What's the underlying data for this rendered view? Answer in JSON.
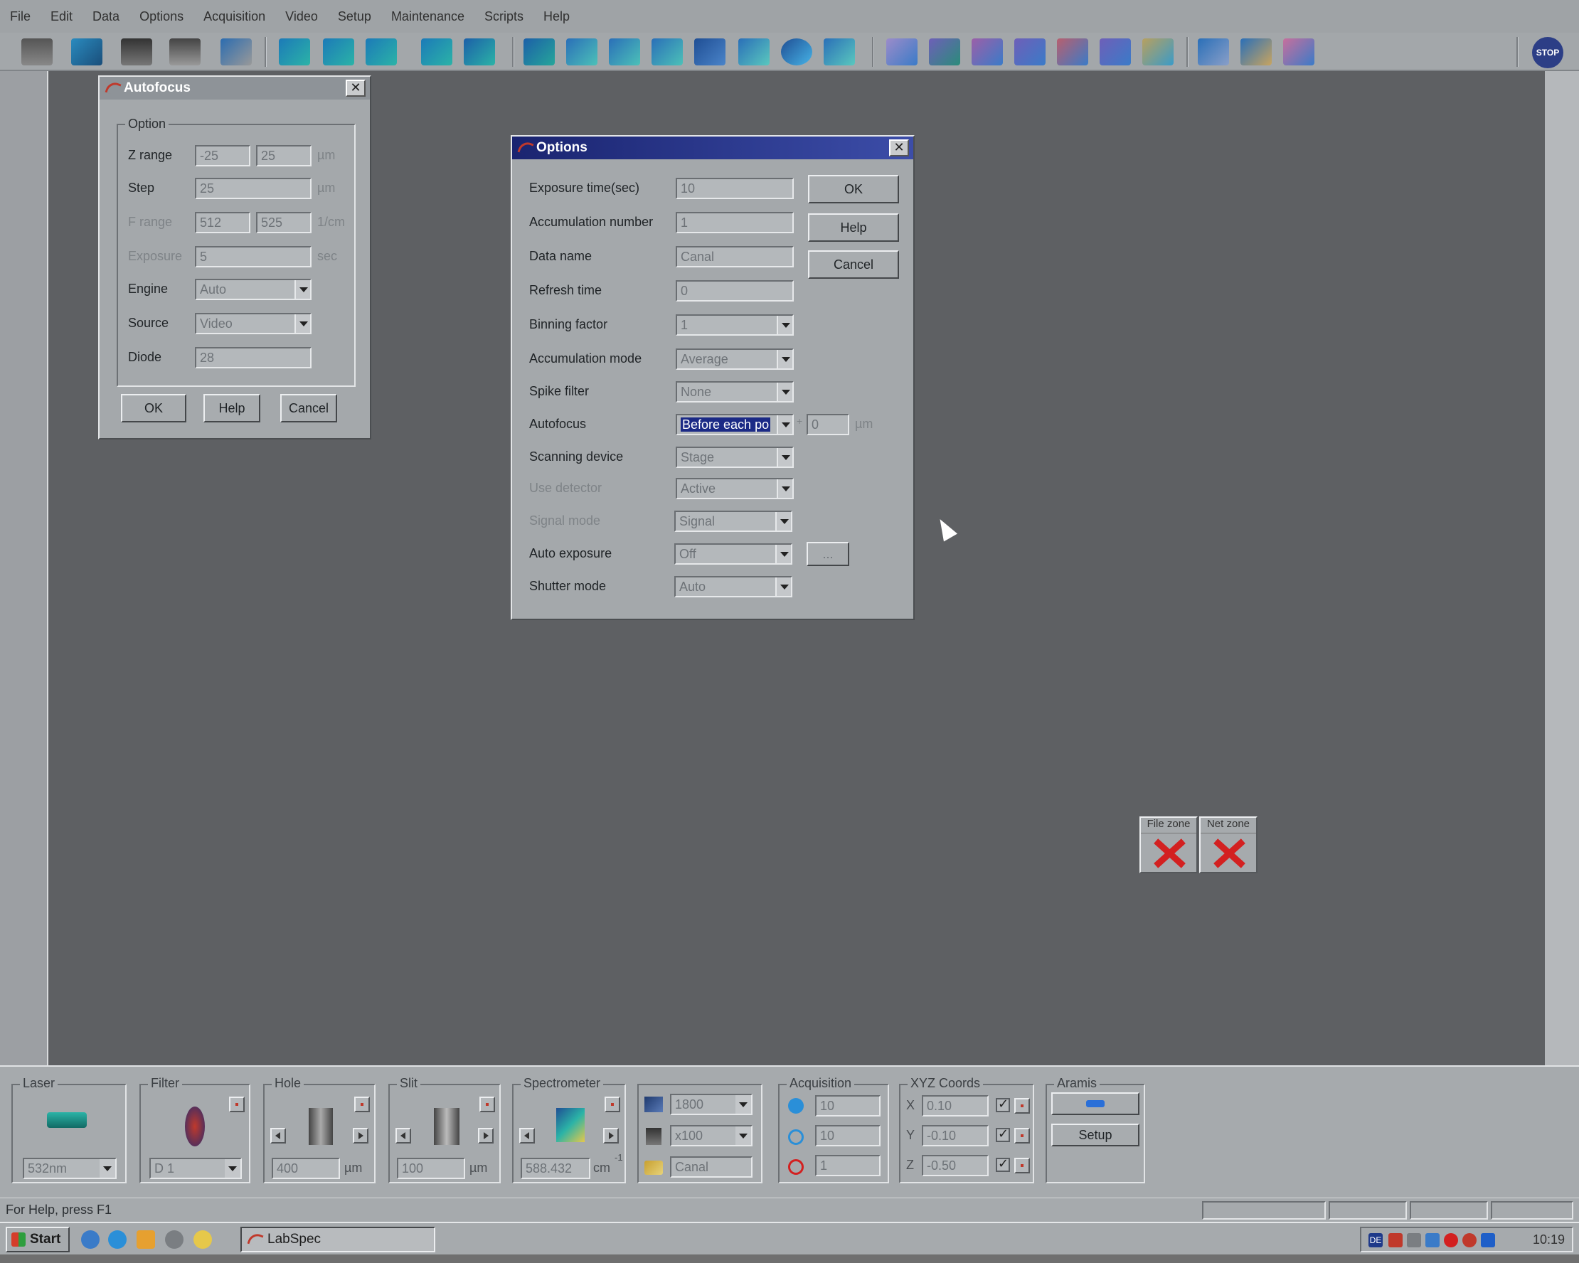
{
  "menu": [
    "File",
    "Edit",
    "Data",
    "Options",
    "Acquisition",
    "Video",
    "Setup",
    "Maintenance",
    "Scripts",
    "Help"
  ],
  "toolbar": {
    "stop_label": "STOP"
  },
  "autofocus_dialog": {
    "title": "Autofocus",
    "group_label": "Option",
    "z_range_label": "Z range",
    "z_range_min": "-25",
    "z_range_max": "25",
    "z_unit": "µm",
    "step_label": "Step",
    "step_value": "25",
    "step_unit": "µm",
    "frange_label": "F range",
    "frange_min": "512",
    "frange_max": "525",
    "frange_unit": "1/cm",
    "exposure_label": "Exposure",
    "exposure_value": "5",
    "exposure_unit": "sec",
    "engine_label": "Engine",
    "engine_value": "Auto",
    "source_label": "Source",
    "source_value": "Video",
    "diode_label": "Diode",
    "diode_value": "28",
    "ok": "OK",
    "help": "Help",
    "cancel": "Cancel"
  },
  "options_dialog": {
    "title": "Options",
    "exposure_time_label": "Exposure time(sec)",
    "exposure_time_value": "10",
    "accumulation_number_label": "Accumulation number",
    "accumulation_number_value": "1",
    "data_name_label": "Data name",
    "data_name_value": "Canal",
    "refresh_time_label": "Refresh time",
    "refresh_time_value": "0",
    "binning_factor_label": "Binning factor",
    "binning_factor_value": "1",
    "accumulation_mode_label": "Accumulation mode",
    "accumulation_mode_value": "Average",
    "spike_filter_label": "Spike filter",
    "spike_filter_value": "None",
    "autofocus_label": "Autofocus",
    "autofocus_value": "Before each po",
    "autofocus_sign": "+",
    "autofocus_offset": "0",
    "autofocus_unit": "µm",
    "scanning_device_label": "Scanning device",
    "scanning_device_value": "Stage",
    "use_detector_label": "Use detector",
    "use_detector_value": "Active",
    "signal_mode_label": "Signal mode",
    "signal_mode_value": "Signal",
    "auto_exposure_label": "Auto exposure",
    "auto_exposure_value": "Off",
    "auto_exposure_more": "...",
    "shutter_mode_label": "Shutter mode",
    "shutter_mode_value": "Auto",
    "ok": "OK",
    "help": "Help",
    "cancel": "Cancel"
  },
  "zones": {
    "file_zone": "File zone",
    "net_zone": "Net zone"
  },
  "panel": {
    "laser_label": "Laser",
    "laser_value": "532nm",
    "filter_label": "Filter",
    "filter_value": "D 1",
    "hole_label": "Hole",
    "hole_value": "400",
    "hole_unit": "µm",
    "slit_label": "Slit",
    "slit_value": "100",
    "slit_unit": "µm",
    "spectrometer_label": "Spectrometer",
    "spectrometer_value": "588.432",
    "spectrometer_unit": "cm",
    "spectrometer_unit_exp": "-1",
    "grating_value": "1800",
    "objective_value": "x100",
    "name_value": "Canal",
    "acquisition_label": "Acquisition",
    "acq_time": "10",
    "acq_accum": "10",
    "acq_count": "1",
    "xyz_label": "XYZ Coords",
    "x_label": "X",
    "x_value": "0.10",
    "y_label": "Y",
    "y_value": "-0.10",
    "z_label": "Z",
    "z_value": "-0.50",
    "aramis_label": "Aramis",
    "aramis_setup": "Setup"
  },
  "statusbar": {
    "help_text": "For Help, press F1"
  },
  "taskbar": {
    "start_label": "Start",
    "task_label": "LabSpec",
    "clock": "10:19",
    "lang": "DE"
  }
}
